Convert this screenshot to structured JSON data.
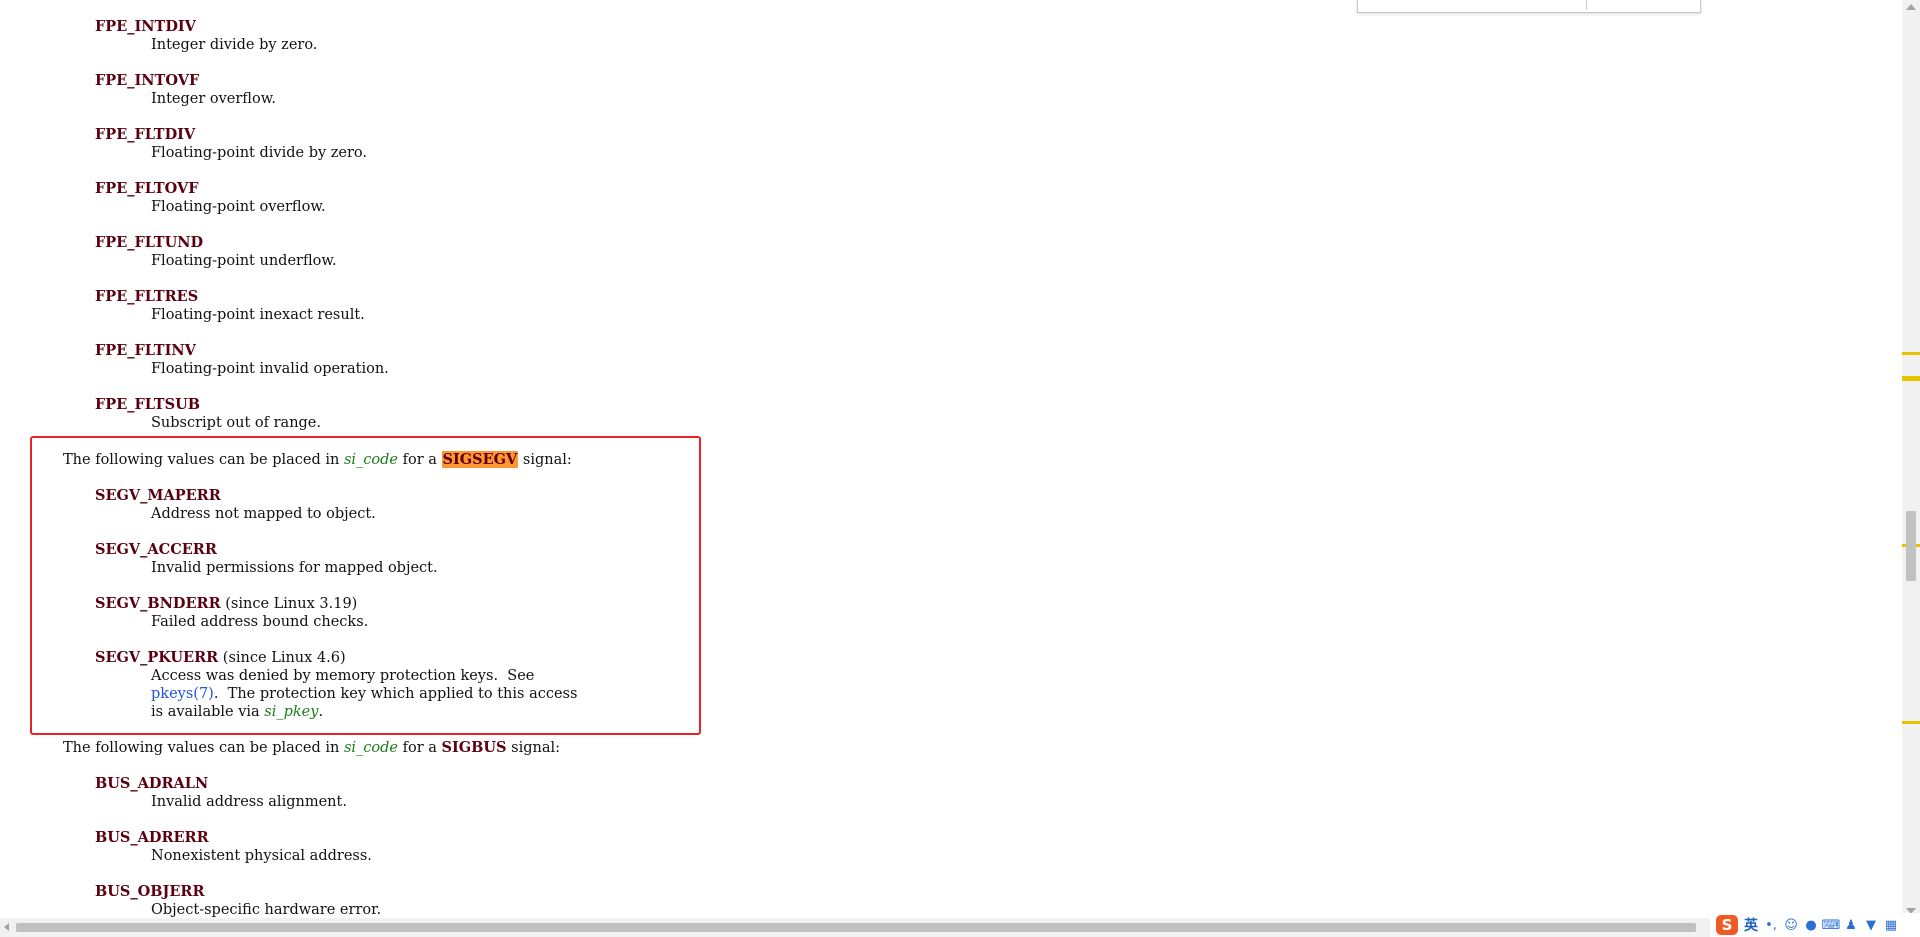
{
  "fpe_entries": [
    {
      "term": "FPE_INTDIV",
      "desc": "Integer divide by zero."
    },
    {
      "term": "FPE_INTOVF",
      "desc": "Integer overflow."
    },
    {
      "term": "FPE_FLTDIV",
      "desc": "Floating-point divide by zero."
    },
    {
      "term": "FPE_FLTOVF",
      "desc": "Floating-point overflow."
    },
    {
      "term": "FPE_FLTUND",
      "desc": "Floating-point underflow."
    },
    {
      "term": "FPE_FLTRES",
      "desc": "Floating-point inexact result."
    },
    {
      "term": "FPE_FLTINV",
      "desc": "Floating-point invalid operation."
    },
    {
      "term": "FPE_FLTSUB",
      "desc": "Subscript out of range."
    }
  ],
  "segv_intro": {
    "prefix": "The following values can be placed in ",
    "var": "si_code",
    "middle": " for a ",
    "signal": "SIGSEGV",
    "suffix": " signal:"
  },
  "segv_entries": [
    {
      "term": "SEGV_MAPERR",
      "note": "",
      "desc": "Address not mapped to object."
    },
    {
      "term": "SEGV_ACCERR",
      "note": "",
      "desc": "Invalid permissions for mapped object."
    },
    {
      "term": "SEGV_BNDERR",
      "note": " (since Linux 3.19)",
      "desc": "Failed address bound checks."
    }
  ],
  "pkuerr": {
    "term": "SEGV_PKUERR",
    "note": " (since Linux 4.6)",
    "line1": "Access was denied by memory protection keys.  See",
    "link": "pkeys(7)",
    "line2_rest": ".  The protection key which applied to this access",
    "line3_prefix": "is available via ",
    "var": "si_pkey",
    "line3_suffix": "."
  },
  "bus_intro": {
    "prefix": "The following values can be placed in ",
    "var": "si_code",
    "middle": " for a ",
    "signal": "SIGBUS",
    "suffix": " signal:"
  },
  "bus_entries": [
    {
      "term": "BUS_ADRALN",
      "desc": "Invalid address alignment."
    },
    {
      "term": "BUS_ADRERR",
      "desc": "Nonexistent physical address."
    },
    {
      "term": "BUS_OBJERR",
      "desc": "Object-specific hardware error."
    }
  ],
  "ime": {
    "logo": "S",
    "lang": "英",
    "punct": "•,",
    "emoji_icon": "smiley-icon",
    "mic_icon": "microphone-icon",
    "keyboard_icon": "keyboard-icon",
    "user_icon": "user-icon",
    "skin_icon": "shirt-icon",
    "grid_icon": "grid-icon"
  },
  "colors": {
    "term": "#5a0010",
    "var": "#1a7d1a",
    "link": "#2255dd",
    "highlight": "#ff9632",
    "redbox": "#e8222a"
  }
}
